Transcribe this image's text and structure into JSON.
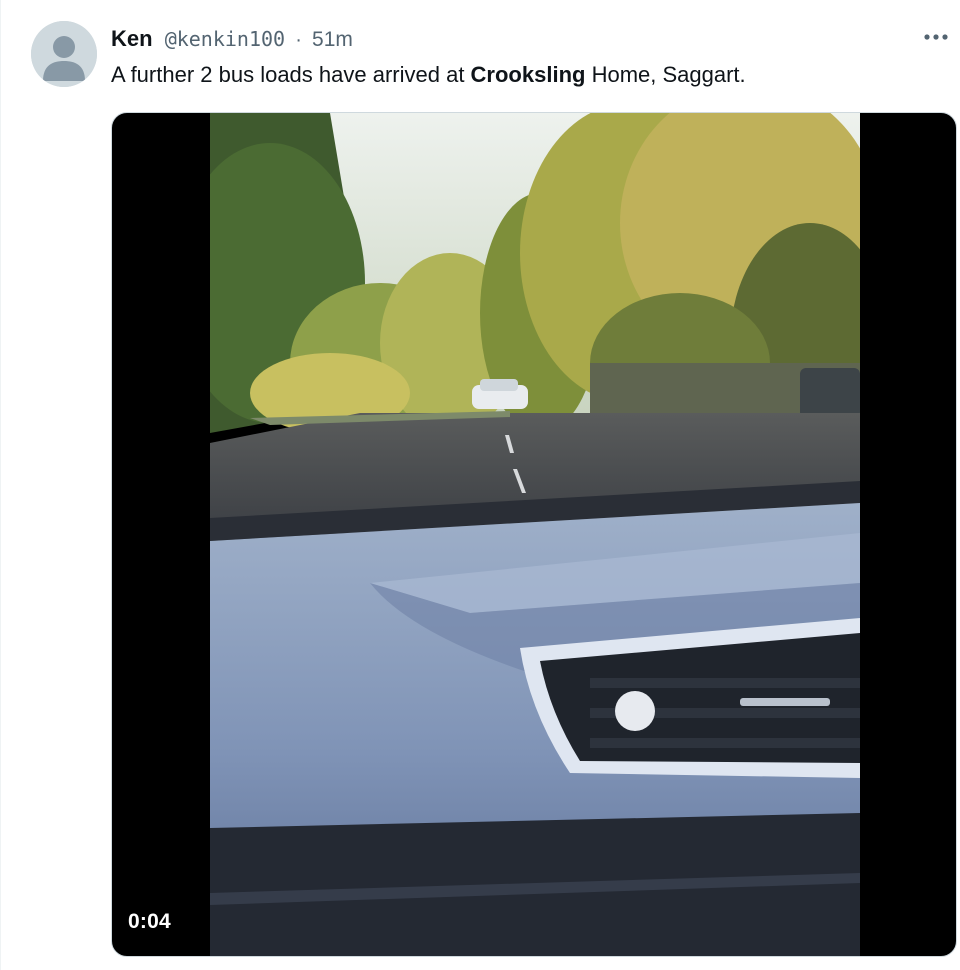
{
  "tweet": {
    "author_name": "Ken",
    "author_handle": "@kenkin100",
    "separator": "·",
    "timestamp": "51m",
    "more_icon": "more-horizontal-icon",
    "text_prefix": "A further 2 bus loads have arrived at ",
    "text_bold": "Crooksling",
    "text_suffix": " Home, Saggart."
  },
  "media": {
    "type": "video",
    "duration": "0:04"
  }
}
